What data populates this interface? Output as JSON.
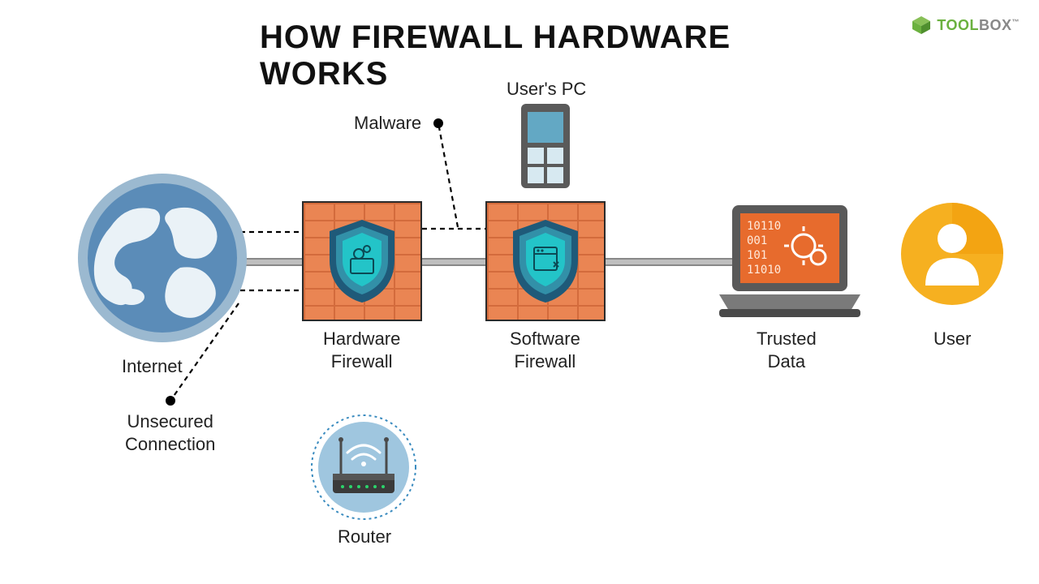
{
  "title": "HOW FIREWALL HARDWARE WORKS",
  "brand": {
    "part1": "TOOL",
    "part2": "BOX",
    "tm": "™"
  },
  "labels": {
    "internet": "Internet",
    "hardware_firewall": "Hardware\nFirewall",
    "software_firewall": "Software\nFirewall",
    "user_pc": "User's PC",
    "trusted_data": "Trusted\nData",
    "user": "User",
    "malware": "Malware",
    "unsecured": "Unsecured\nConnection",
    "router": "Router"
  },
  "diagram": {
    "flow": [
      "Internet",
      "Hardware Firewall",
      "Software Firewall",
      "Trusted Data",
      "User"
    ],
    "callouts": [
      {
        "name": "Malware",
        "blocked_at": "between Hardware and Software Firewall"
      },
      {
        "name": "Unsecured Connection",
        "blocked_at": "before Hardware Firewall"
      }
    ],
    "attached": [
      {
        "name": "User's PC",
        "to": "Software Firewall"
      },
      {
        "name": "Router",
        "near": "Hardware Firewall"
      }
    ],
    "binary_text": [
      "10110",
      "001",
      "101",
      "11010"
    ]
  },
  "colors": {
    "globe_fill": "#5b8cb8",
    "globe_ring": "#9bb9d0",
    "brick": "#ea8553",
    "brick_line": "#d36b3c",
    "shield_outer": "#1f5a79",
    "shield_mid": "#3290a8",
    "shield_inner": "#23c4c8",
    "laptop_body": "#595959",
    "laptop_screen": "#e76b2d",
    "user_circle": "#f6b020",
    "router_bg": "#9fc6df",
    "green": "#6bb13f"
  }
}
